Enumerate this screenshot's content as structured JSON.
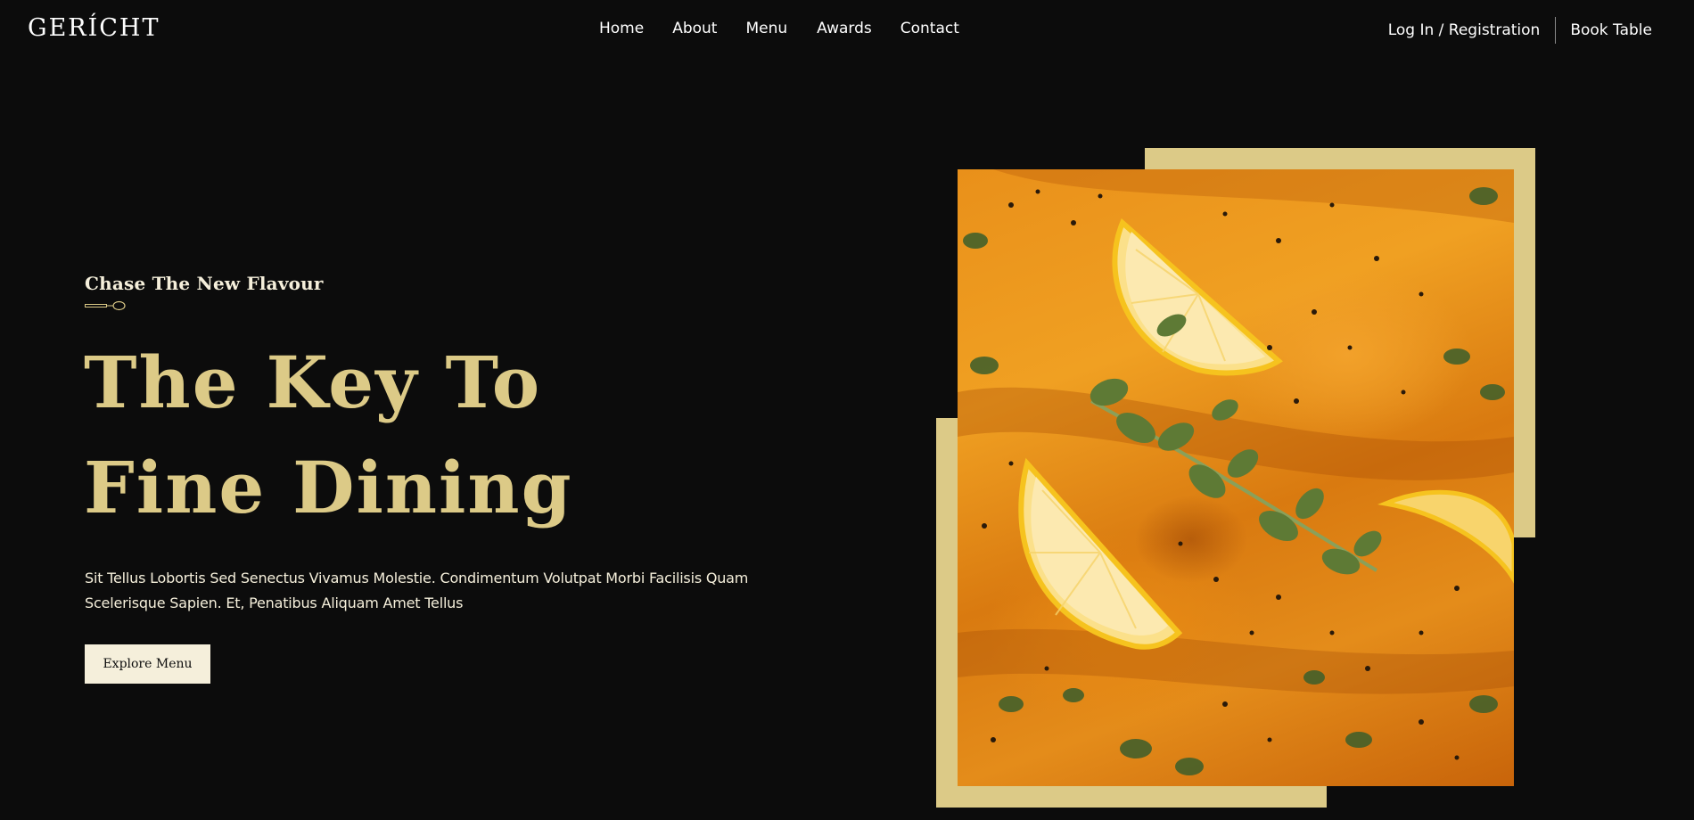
{
  "brand": {
    "logo": "GERÍCHT"
  },
  "nav": {
    "links": [
      {
        "label": "Home"
      },
      {
        "label": "About"
      },
      {
        "label": "Menu"
      },
      {
        "label": "Awards"
      },
      {
        "label": "Contact"
      }
    ],
    "login_label": "Log In / Registration",
    "book_label": "Book Table"
  },
  "hero": {
    "subtitle": "Chase The New Flavour",
    "title": "The Key To Fine Dining",
    "description": "Sit Tellus Lobortis Sed Senectus Vivamus Molestie. Condimentum Volutpat Morbi Facilisis Quam Scelerisque Sapien. Et, Penatibus Aliquam Amet Tellus",
    "cta_label": "Explore Menu",
    "image_alt": "Salmon fillets in orange sauce with lemon slices and oregano"
  },
  "colors": {
    "background": "#0C0C0C",
    "gold": "#DCCA87",
    "cream": "#F5EFDB",
    "white": "#FFFFFF"
  }
}
